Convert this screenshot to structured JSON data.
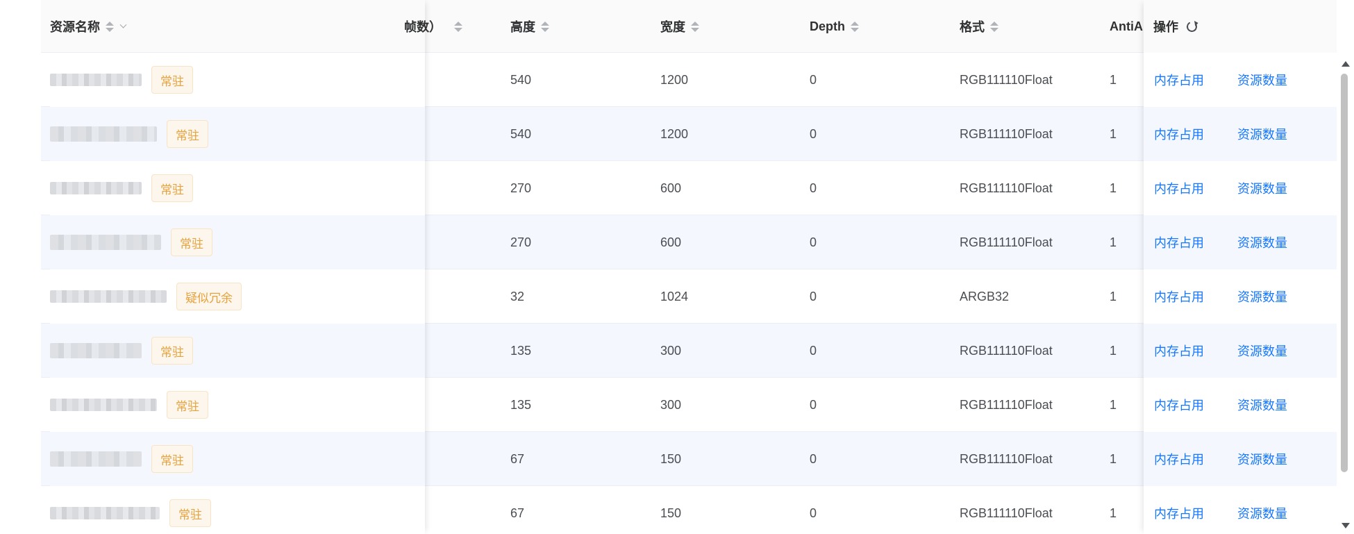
{
  "columns": {
    "name": "资源名称",
    "frames": "帧数）",
    "height": "高度",
    "width": "宽度",
    "depth": "Depth",
    "format": "格式",
    "antialias": "AntiAl",
    "actions": "操作"
  },
  "action_labels": {
    "memory": "内存占用",
    "count": "资源数量"
  },
  "rows": [
    {
      "tag": "常驻",
      "height": "540",
      "width": "1200",
      "depth": "0",
      "format": "RGB111110Float",
      "antialias": "1"
    },
    {
      "tag": "常驻",
      "height": "540",
      "width": "1200",
      "depth": "0",
      "format": "RGB111110Float",
      "antialias": "1"
    },
    {
      "tag": "常驻",
      "height": "270",
      "width": "600",
      "depth": "0",
      "format": "RGB111110Float",
      "antialias": "1"
    },
    {
      "tag": "常驻",
      "height": "270",
      "width": "600",
      "depth": "0",
      "format": "RGB111110Float",
      "antialias": "1"
    },
    {
      "tag": "疑似冗余",
      "height": "32",
      "width": "1024",
      "depth": "0",
      "format": "ARGB32",
      "antialias": "1"
    },
    {
      "tag": "常驻",
      "height": "135",
      "width": "300",
      "depth": "0",
      "format": "RGB111110Float",
      "antialias": "1"
    },
    {
      "tag": "常驻",
      "height": "135",
      "width": "300",
      "depth": "0",
      "format": "RGB111110Float",
      "antialias": "1"
    },
    {
      "tag": "常驻",
      "height": "67",
      "width": "150",
      "depth": "0",
      "format": "RGB111110Float",
      "antialias": "1"
    },
    {
      "tag": "常驻",
      "height": "67",
      "width": "150",
      "depth": "0",
      "format": "RGB111110Float",
      "antialias": "1"
    }
  ],
  "colors": {
    "link": "#1677ff",
    "tag_text": "#e6a23c",
    "tag_bg": "#fdf6ec",
    "stripe": "#f4f8fe"
  },
  "icons": [
    "sort-icon",
    "chevron-down-icon",
    "refresh-icon"
  ]
}
